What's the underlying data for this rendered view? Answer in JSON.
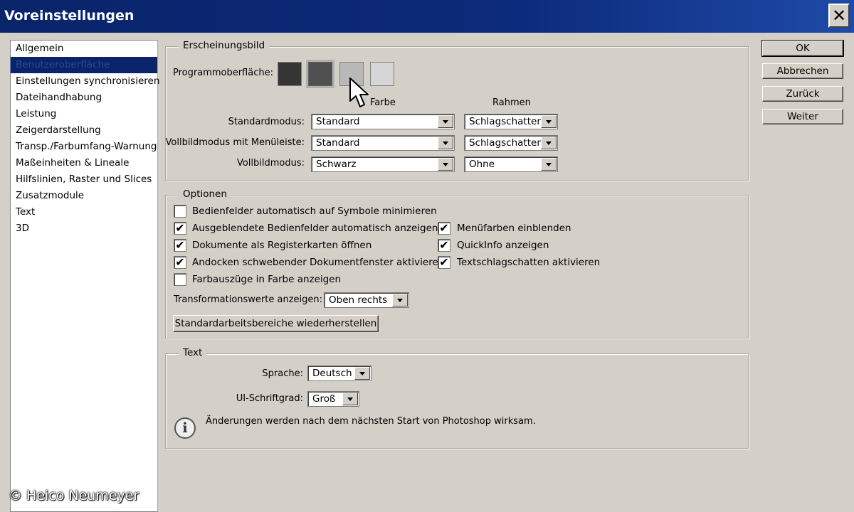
{
  "window": {
    "title": "Voreinstellungen"
  },
  "sidebar": {
    "items": [
      {
        "label": "Allgemein"
      },
      {
        "label": "Benutzeroberfläche",
        "selected": true
      },
      {
        "label": "Einstellungen synchronisieren"
      },
      {
        "label": "Dateihandhabung"
      },
      {
        "label": "Leistung"
      },
      {
        "label": "Zeigerdarstellung"
      },
      {
        "label": "Transp./Farbumfang-Warnung"
      },
      {
        "label": "Maßeinheiten & Lineale"
      },
      {
        "label": "Hilfslinien, Raster und Slices"
      },
      {
        "label": "Zusatzmodule"
      },
      {
        "label": "Text"
      },
      {
        "label": "3D"
      }
    ]
  },
  "appearance": {
    "legend": "Erscheinungsbild",
    "theme_label": "Programmoberfläche:",
    "swatches": [
      {
        "color": "#353535"
      },
      {
        "color": "#505050",
        "selected": true
      },
      {
        "color": "#b8b8b8"
      },
      {
        "color": "#d6d6d6"
      }
    ],
    "col_color": "Farbe",
    "col_border": "Rahmen",
    "standard_label": "Standardmodus:",
    "standard_color": "Standard",
    "standard_border": "Schlagschatten",
    "fullmenu_label": "Vollbildmodus mit Menüleiste:",
    "fullmenu_color": "Standard",
    "fullmenu_border": "Schlagschatten",
    "full_label": "Vollbildmodus:",
    "full_color": "Schwarz",
    "full_border": "Ohne"
  },
  "options": {
    "legend": "Optionen",
    "left": [
      {
        "label": "Bedienfelder automatisch auf Symbole minimieren",
        "checked": false
      },
      {
        "label": "Ausgeblendete Bedienfelder automatisch anzeigen",
        "checked": true
      },
      {
        "label": "Dokumente als Registerkarten öffnen",
        "checked": true
      },
      {
        "label": "Andocken schwebender Dokumentfenster aktivieren",
        "checked": true
      },
      {
        "label": "Farbauszüge in Farbe anzeigen",
        "checked": false
      }
    ],
    "right": [
      {
        "label": "Menüfarben einblenden",
        "checked": true
      },
      {
        "label": "QuickInfo anzeigen",
        "checked": true
      },
      {
        "label": "Textschlagschatten aktivieren",
        "checked": true
      }
    ],
    "transform_label": "Transformationswerte anzeigen:",
    "transform_value": "Oben rechts",
    "restore_button": "Standardarbeitsbereiche wiederherstellen"
  },
  "text": {
    "legend": "Text",
    "language_label": "Sprache:",
    "language_value": "Deutsch",
    "fontsize_label": "UI-Schriftgrad:",
    "fontsize_value": "Groß",
    "info": "Änderungen werden nach dem nächsten Start von Photoshop wirksam.",
    "info_icon": "info-icon"
  },
  "buttons": {
    "ok": "OK",
    "cancel": "Abbrechen",
    "back": "Zurück",
    "next": "Weiter"
  },
  "copyright": "© Heico Neumeyer",
  "checkmark": "✔"
}
